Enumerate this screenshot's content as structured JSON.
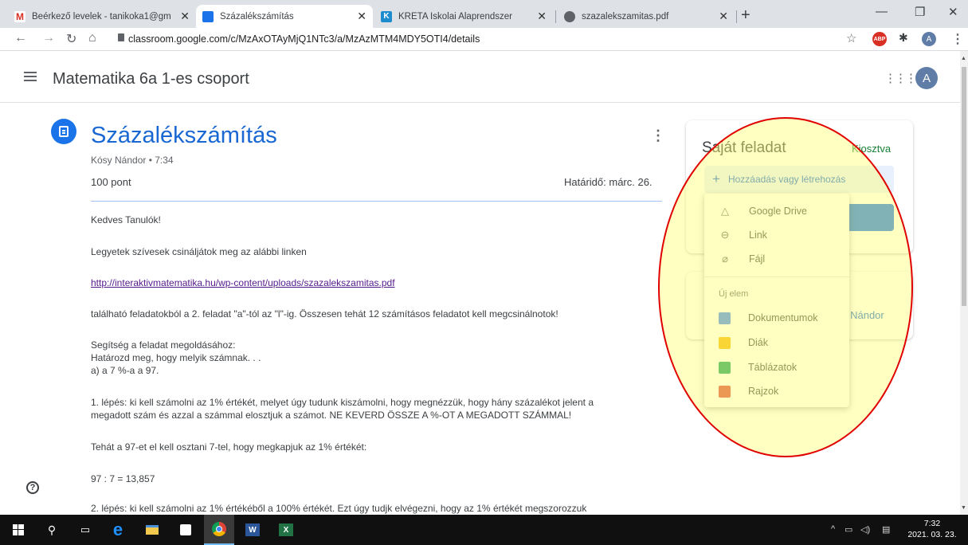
{
  "browser": {
    "tabs": [
      {
        "title": "Beérkező levelek - tanikoka1@gm",
        "icon": "gmail-icon",
        "color": "#d93025",
        "active": false
      },
      {
        "title": "Százalékszámítás",
        "icon": "classroom-icon",
        "color": "#1a73e8",
        "active": true
      },
      {
        "title": "KRÉTA Iskolai Alaprendszer",
        "icon": "kreta-icon",
        "color": "#1d8ccf",
        "active": false
      },
      {
        "title": "szazalekszamitas.pdf",
        "icon": "globe-icon",
        "color": "#5f6368",
        "active": false
      }
    ],
    "url": "classroom.google.com/c/MzAxOTAyMjQ1NTc3/a/MzAzMTM4MDY5OTI4/details",
    "abp_label": "ABP",
    "profile_initial": "A"
  },
  "header": {
    "course_name": "Matematika 6a 1-es csoport",
    "avatar_initial": "A"
  },
  "assignment": {
    "title": "Százalékszámítás",
    "meta": "Kósy Nándor • 7:34",
    "points": "100 pont",
    "due": "Határidő: márc. 26.",
    "paragraphs": [
      "Kedves Tanulók!",
      "Legyetek szívesek csináljátok meg az alábbi linken",
      "található feladatokból a 2. feladat \"a\"-tól az \"l\"-ig. Összesen tehát 12 számításos feladatot kell megcsinálnotok!",
      "Segítség a feladat megoldásához:",
      "Határozd meg, hogy melyik számnak. . .",
      "a) a 7 %-a a 97.",
      "1. lépés: ki kell számolni az 1% értékét, melyet úgy tudunk kiszámolni, hogy megnézzük, hogy hány százalékot jelent a",
      "megadott szám és azzal a számmal elosztjuk a számot. NE KEVERD ÖSSZE A %-OT A MEGADOTT SZÁMMAL!",
      "Tehát a 97-et el kell osztani 7-tel, hogy megkapjuk az 1% értékét:",
      "97 : 7 = 13,857",
      "2. lépés: ki kell számolni az 1% értékéből a 100% értékét. Ezt úgy tudjk elvégezni, hogy az 1% értékét megszorozzuk"
    ],
    "link": "http://interaktivmatematika.hu/wp-content/uploads/szazalekszamitas.pdf"
  },
  "your_work": {
    "title": "Saját feladat",
    "status": "Kiosztva",
    "add_button": "Hozzáadás vagy létrehozás",
    "card2_fragment": "' Nándor"
  },
  "menu": {
    "attach_items": [
      {
        "label": "Google Drive",
        "icon": "drive-icon"
      },
      {
        "label": "Link",
        "icon": "link-icon"
      },
      {
        "label": "Fájl",
        "icon": "paperclip-icon"
      }
    ],
    "new_header": "Új elem",
    "new_items": [
      {
        "label": "Dokumentumok",
        "icon": "docs-icon",
        "color": "#4285f4"
      },
      {
        "label": "Diák",
        "icon": "slides-icon",
        "color": "#f4b400"
      },
      {
        "label": "Táblázatok",
        "icon": "sheets-icon",
        "color": "#0f9d58"
      },
      {
        "label": "Rajzok",
        "icon": "drawings-icon",
        "color": "#db4437"
      }
    ]
  },
  "taskbar": {
    "time": "7:32",
    "date": "2021. 03. 23."
  },
  "colors": {
    "accent": "#1967d2",
    "status_green": "#188038",
    "annotation_red": "#e00000",
    "annotation_yellow": "#ffff78"
  }
}
